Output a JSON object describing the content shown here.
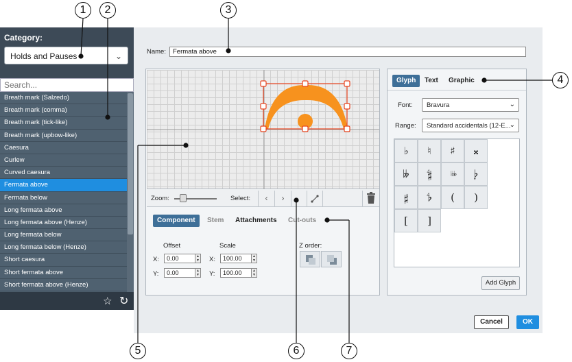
{
  "sidebar": {
    "category_label": "Category:",
    "category_value": "Holds and Pauses",
    "search_placeholder": "Search...",
    "items": [
      "Breath mark (Salzedo)",
      "Breath mark (comma)",
      "Breath mark (tick-like)",
      "Breath mark (upbow-like)",
      "Caesura",
      "Curlew",
      "Curved caesura",
      "Fermata above",
      "Fermata below",
      "Long fermata above",
      "Long fermata above (Henze)",
      "Long fermata below",
      "Long fermata below (Henze)",
      "Short caesura",
      "Short fermata above",
      "Short fermata above (Henze)"
    ],
    "selected_item": "Fermata above"
  },
  "name_field": {
    "label": "Name:",
    "value": "Fermata above"
  },
  "editor": {
    "zoom_label": "Zoom:",
    "select_label": "Select:",
    "tabs": [
      "Component",
      "Stem",
      "Attachments",
      "Cut-outs"
    ],
    "active_tab": "Component",
    "offset_label": "Offset",
    "scale_label": "Scale",
    "z_order_label": "Z order:",
    "offset_x_label": "X:",
    "offset_y_label": "Y:",
    "scale_x_label": "X:",
    "scale_y_label": "Y:",
    "offset_x": "0.00",
    "offset_y": "0.00",
    "scale_x": "100.00",
    "scale_y": "100.00"
  },
  "glyph_panel": {
    "tabs": [
      "Glyph",
      "Text",
      "Graphic"
    ],
    "active_tab": "Glyph",
    "font_label": "Font:",
    "font_value": "Bravura",
    "range_label": "Range:",
    "range_value": "Standard accidentals (12-E...",
    "glyphs": [
      "♭",
      "♮",
      "♯",
      "𝄪",
      "𝄫",
      "𝄲",
      "♭♭♭",
      "𝄭",
      "𝄰",
      "𝄳",
      "(",
      ")",
      "[",
      "]"
    ],
    "add_glyph_label": "Add Glyph"
  },
  "footer": {
    "cancel_label": "Cancel",
    "ok_label": "OK"
  },
  "callouts": [
    "1",
    "2",
    "3",
    "4",
    "5",
    "6",
    "7"
  ],
  "colors": {
    "accent": "#1f8ee0",
    "sidebar": "#3d4a57",
    "glyph": "#f7921e",
    "selection": "#e8431e"
  }
}
